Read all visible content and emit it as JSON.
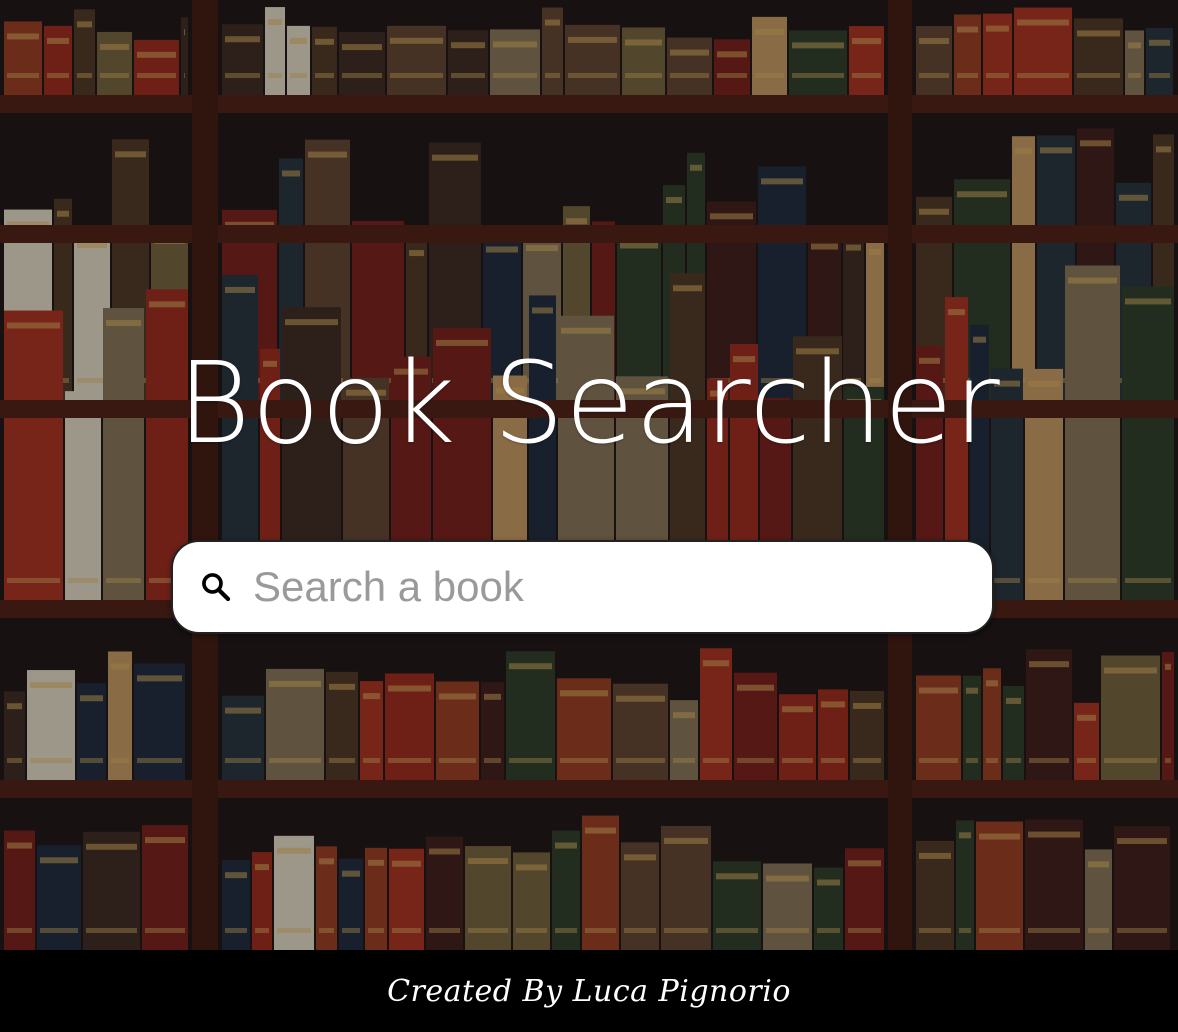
{
  "hero": {
    "title": "Book Searcher",
    "background": "bookshelf-photo"
  },
  "search": {
    "placeholder": "Search a book",
    "value": "",
    "icon": "search-icon"
  },
  "footer": {
    "credit": "Created By Luca Pignorio"
  },
  "colors": {
    "title": "#ffffff",
    "search_bg": "#ffffff",
    "footer_bg": "#000000",
    "shelf_wood": "#4a1f16"
  }
}
